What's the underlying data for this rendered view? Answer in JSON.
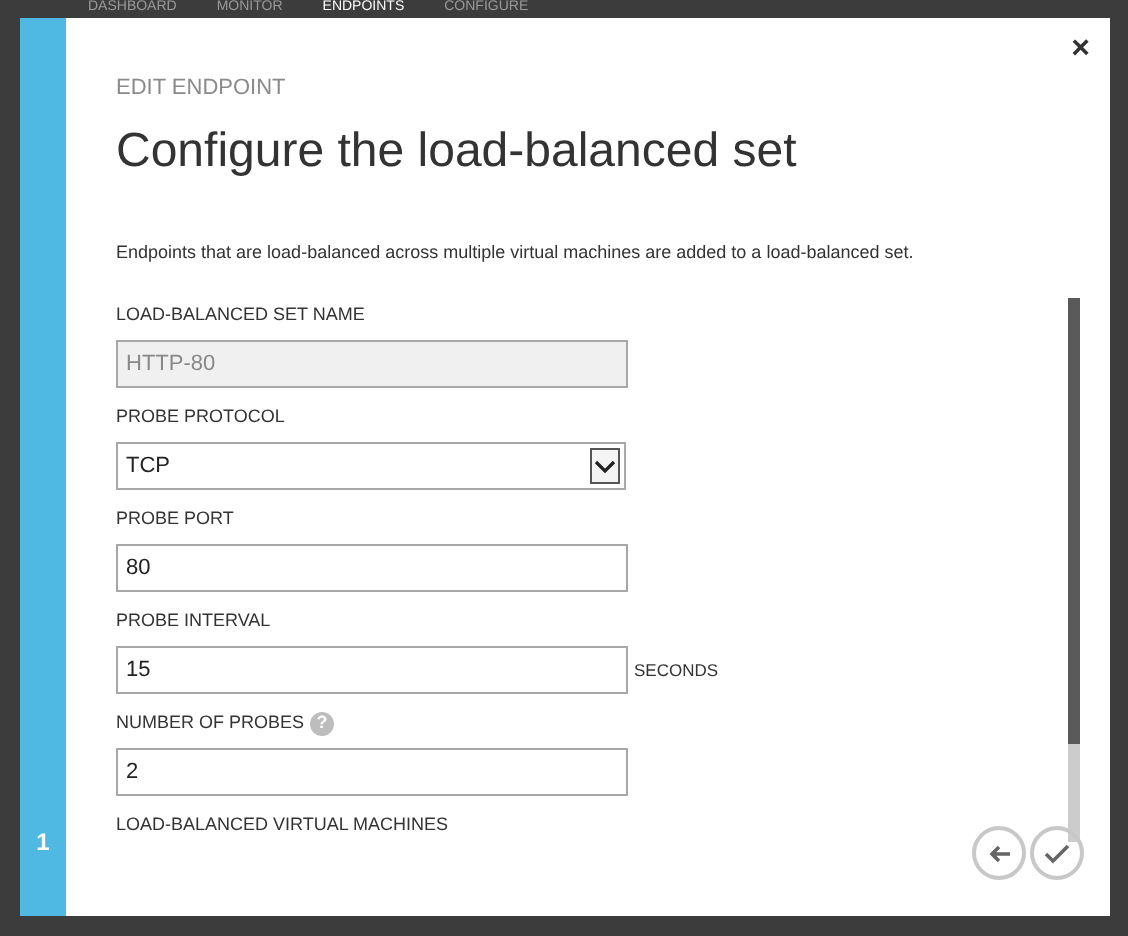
{
  "nav": [
    {
      "label": "DASHBOARD",
      "selected": false
    },
    {
      "label": "MONITOR",
      "selected": false
    },
    {
      "label": "ENDPOINTS",
      "selected": true
    },
    {
      "label": "CONFIGURE",
      "selected": false
    }
  ],
  "dialog": {
    "subtitle": "EDIT ENDPOINT",
    "title": "Configure the load-balanced set",
    "description": "Endpoints that are load-balanced across multiple virtual machines are added to a load-balanced set.",
    "close": "×",
    "step": "1",
    "fields": [
      {
        "kind": "text",
        "label": "LOAD-BALANCED SET NAME",
        "value": "HTTP-80",
        "disabled": true
      },
      {
        "kind": "select",
        "label": "PROBE PROTOCOL",
        "value": "TCP",
        "disabled": false
      },
      {
        "kind": "text",
        "label": "PROBE PORT",
        "value": "80",
        "disabled": false
      },
      {
        "kind": "text",
        "label": "PROBE INTERVAL",
        "value": "15",
        "suffix": "SECONDS",
        "disabled": false
      },
      {
        "kind": "text",
        "label": "NUMBER OF PROBES",
        "value": "2",
        "help": "?",
        "disabled": false
      },
      {
        "kind": "heading",
        "label": "LOAD-BALANCED VIRTUAL MACHINES"
      }
    ]
  }
}
